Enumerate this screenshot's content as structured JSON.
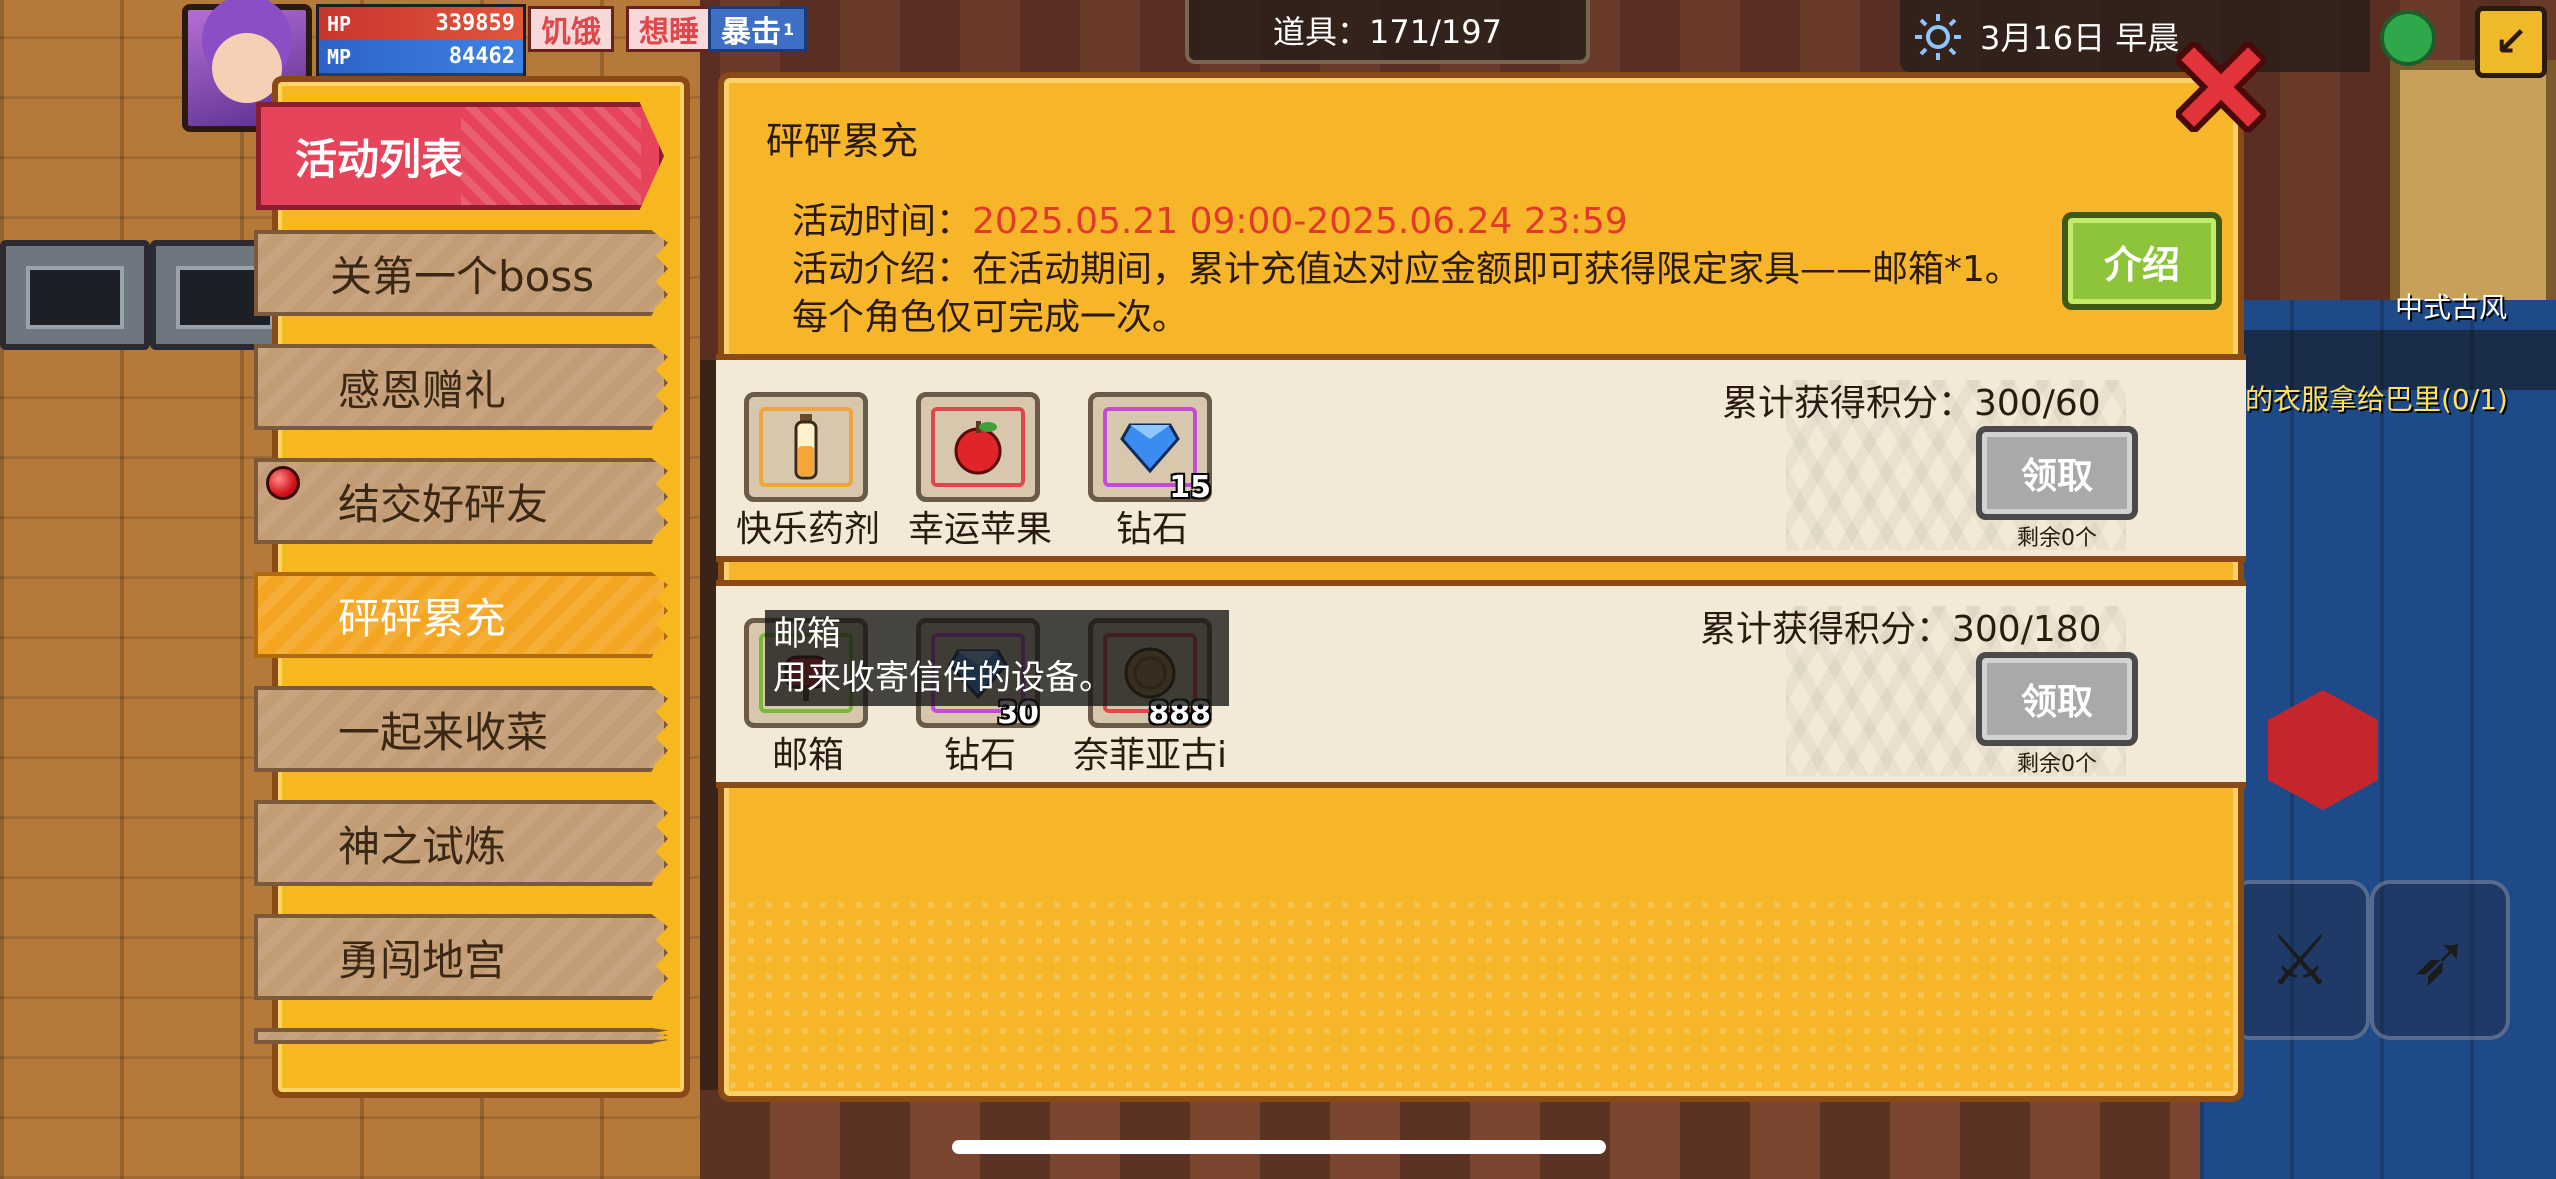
{
  "hud": {
    "hp_label": "HP",
    "hp_value": "339859",
    "mp_label": "MP",
    "mp_value": "84462",
    "status_hungry": "饥饿",
    "status_sleepy": "想睡",
    "status_crit": "暴击",
    "status_crit_level": "1",
    "items_counter": "道具：171/197",
    "date": "3月16日 早晨",
    "side_label": "中式古风",
    "quest_text": "的衣服拿给巴里(0/1)"
  },
  "sidebar": {
    "title": "活动列表",
    "items": [
      {
        "label": "关第一个boss",
        "active": false
      },
      {
        "label": "感恩赠礼",
        "active": false
      },
      {
        "label": "结交好砰友",
        "active": false,
        "badge": true
      },
      {
        "label": "砰砰累充",
        "active": true
      },
      {
        "label": "一起来收菜",
        "active": false
      },
      {
        "label": "神之试炼",
        "active": false
      },
      {
        "label": "勇闯地宫",
        "active": false
      }
    ]
  },
  "activity": {
    "title": "砰砰累充",
    "time_label": "活动时间：",
    "time_value": "2025.05.21 09:00-2025.06.24 23:59",
    "desc_label": "活动介绍：",
    "desc_value": "在活动期间，累计充值达对应金额即可获得限定家具——邮箱*1。每个角色仅可完成一次。",
    "intro_button": "介绍",
    "colors": {
      "time": "#e23a2a",
      "panel": "#f7b62a",
      "active_tab": "#f4a623",
      "header_tab": "#e6445a"
    }
  },
  "rewards": [
    {
      "score": "累计获得积分：300/60",
      "claim": "领取",
      "remaining": "剩余0个",
      "items": [
        {
          "name": "快乐药剂",
          "qty": "",
          "icon": "potion-icon"
        },
        {
          "name": "幸运苹果",
          "qty": "",
          "icon": "apple-icon"
        },
        {
          "name": "钻石",
          "qty": "15",
          "icon": "diamond-icon"
        }
      ]
    },
    {
      "score": "累计获得积分：300/180",
      "claim": "领取",
      "remaining": "剩余0个",
      "items": [
        {
          "name": "邮箱",
          "qty": "",
          "icon": "mailbox-icon"
        },
        {
          "name": "钻石",
          "qty": "30",
          "icon": "diamond-icon"
        },
        {
          "name": "奈菲亚古i",
          "qty": "888",
          "icon": "coin-icon"
        }
      ]
    }
  ],
  "tooltip": {
    "title": "邮箱",
    "body": "用来收寄信件的设备。"
  }
}
